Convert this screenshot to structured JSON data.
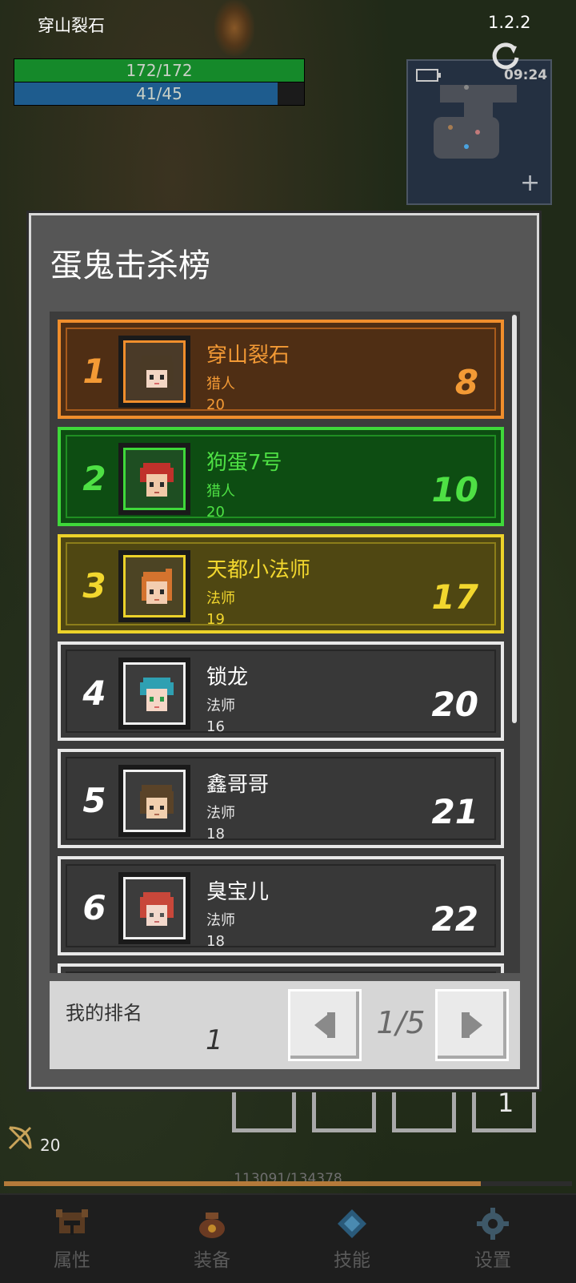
{
  "hud": {
    "player_name": "穿山裂石",
    "version": "1.2.2",
    "hp_text": "172/172",
    "hp_fraction": 1.0,
    "mp_text": "41/45",
    "mp_fraction": 0.91,
    "clock": "09:24"
  },
  "modal": {
    "title": "蛋鬼击杀榜",
    "entries": [
      {
        "rank": "1",
        "name": "穿山裂石",
        "class": "猎人",
        "level": "20",
        "kills": "8"
      },
      {
        "rank": "2",
        "name": "狗蛋7号",
        "class": "猎人",
        "level": "20",
        "kills": "10"
      },
      {
        "rank": "3",
        "name": "天都小法师",
        "class": "法师",
        "level": "19",
        "kills": "17"
      },
      {
        "rank": "4",
        "name": "锁龙",
        "class": "法师",
        "level": "16",
        "kills": "20"
      },
      {
        "rank": "5",
        "name": "鑫哥哥",
        "class": "法师",
        "level": "18",
        "kills": "21"
      },
      {
        "rank": "6",
        "name": "臭宝儿",
        "class": "法师",
        "level": "18",
        "kills": "22"
      }
    ],
    "my_rank_label": "我的排名",
    "my_rank_value": "1",
    "page_text": "1/5"
  },
  "bottom": {
    "slot_count": "1",
    "ammo": "20",
    "exp_text": "113091/134378",
    "exp_fraction": 0.84,
    "nav": [
      {
        "label": "属性",
        "icon": "helmet-icon"
      },
      {
        "label": "装备",
        "icon": "bag-icon"
      },
      {
        "label": "技能",
        "icon": "crystal-icon"
      },
      {
        "label": "设置",
        "icon": "gear-icon"
      }
    ]
  },
  "colors": {
    "gold": "#f08e2c",
    "green": "#3fd83a",
    "yellow": "#ecd22a",
    "hp": "#15892a",
    "mp": "#1e5c8e"
  }
}
